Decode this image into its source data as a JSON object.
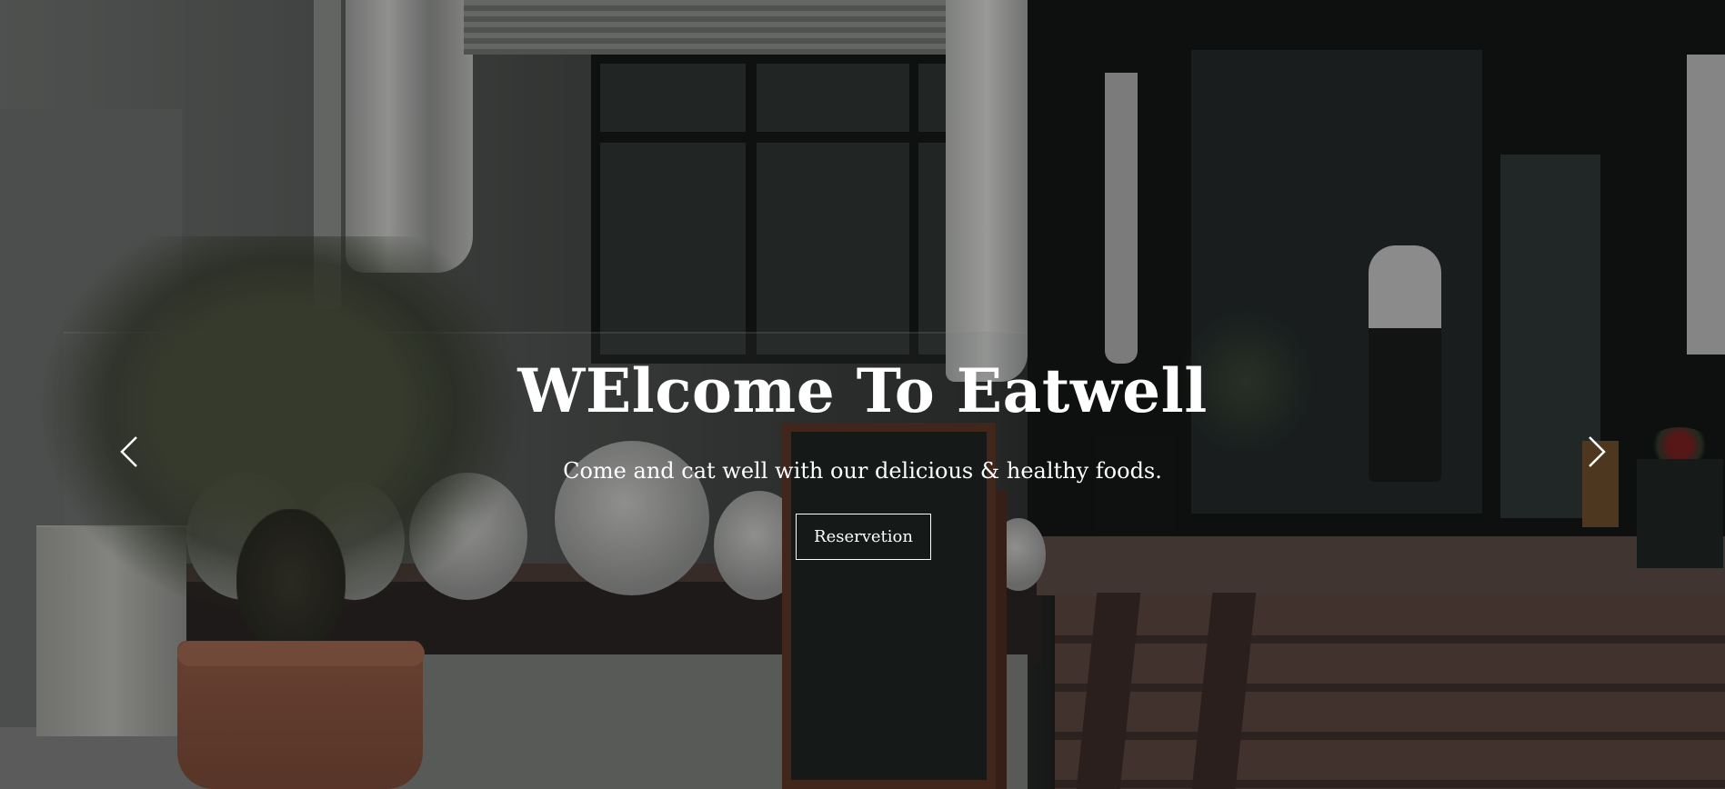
{
  "hero": {
    "title": "WElcome To Eatwell",
    "subtitle": "Come and cat well with our delicious & healthy foods.",
    "button_label": "Reservetion"
  },
  "carousel": {
    "prev_icon": "chevron-left-icon",
    "next_icon": "chevron-right-icon"
  },
  "colors": {
    "text": "#ffffff",
    "overlay": "#000000"
  }
}
